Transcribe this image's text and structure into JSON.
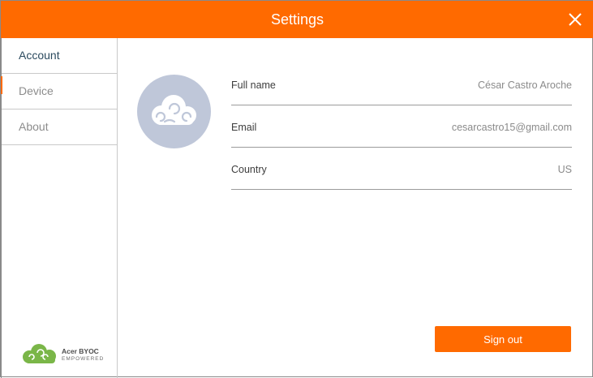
{
  "window": {
    "title": "Settings"
  },
  "sidebar": {
    "items": [
      {
        "label": "Account",
        "active": true
      },
      {
        "label": "Device",
        "active": false
      },
      {
        "label": "About",
        "active": false
      }
    ]
  },
  "logo": {
    "line1": "Acer BYOC",
    "line2": "EMPOWERED"
  },
  "account": {
    "fields": [
      {
        "label": "Full name",
        "value": "César Castro Aroche"
      },
      {
        "label": "Email",
        "value": "cesarcastro15@gmail.com"
      },
      {
        "label": "Country",
        "value": "US"
      }
    ],
    "sign_out_label": "Sign out"
  },
  "colors": {
    "accent": "#ff6a00",
    "avatar_bg": "#bfc7d9",
    "logo_green": "#7ab648"
  },
  "icons": {
    "close": "close-icon",
    "avatar": "cloud-avatar-icon",
    "logo": "acer-byoc-logo"
  }
}
